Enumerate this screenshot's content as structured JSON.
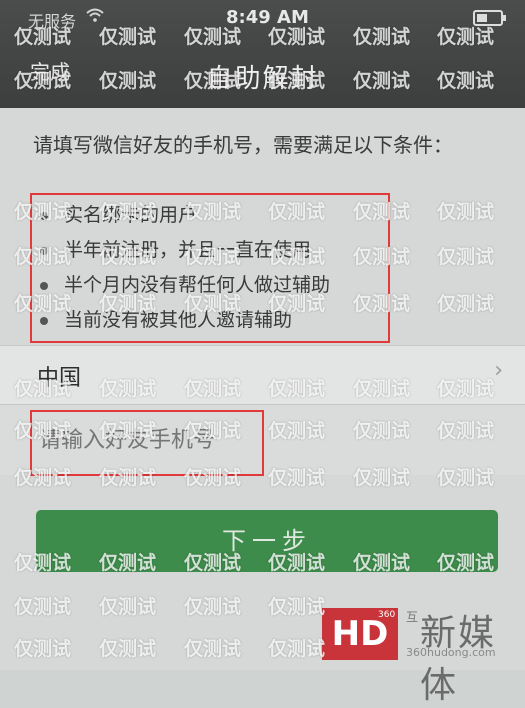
{
  "status_bar": {
    "carrier": "无服务",
    "time": "8:49 AM"
  },
  "nav": {
    "back_label": "完成",
    "title": "自助解封"
  },
  "intro_text": "请填写微信好友的手机号，需要满足以下条件：",
  "requirements": [
    "实名绑卡的用户",
    "半年前注册，并且一直在使用",
    "半个月内没有帮任何人做过辅助",
    "当前没有被其他人邀请辅助"
  ],
  "region": {
    "label": "中国",
    "chevron": "›"
  },
  "phone_input": {
    "placeholder": "请输入好友手机号"
  },
  "next_button": {
    "label": "下一步"
  },
  "watermark": {
    "text": "仅测试"
  },
  "logo": {
    "hd": "HD",
    "badge": "360",
    "hu": "互",
    "name": "新媒体",
    "url": "360hudong.com"
  }
}
